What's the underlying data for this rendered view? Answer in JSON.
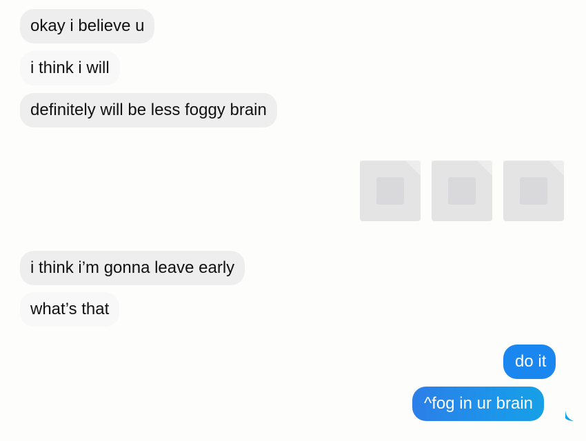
{
  "conversation": {
    "received_top": [
      "okay i believe u",
      "i think i will",
      "definitely will be less foggy brain"
    ],
    "attachments": [
      {
        "icon": "image-thumbnail-icon"
      },
      {
        "icon": "image-thumbnail-icon"
      },
      {
        "icon": "image-thumbnail-icon"
      }
    ],
    "received_bottom": [
      "i think i’m gonna leave early",
      "what’s that"
    ],
    "sent": [
      "do it",
      "^fog in ur brain"
    ]
  },
  "colors": {
    "incoming_bubble": "#eeeeef",
    "outgoing_bubble": "#1a86f0",
    "background": "#fdfdfc"
  }
}
